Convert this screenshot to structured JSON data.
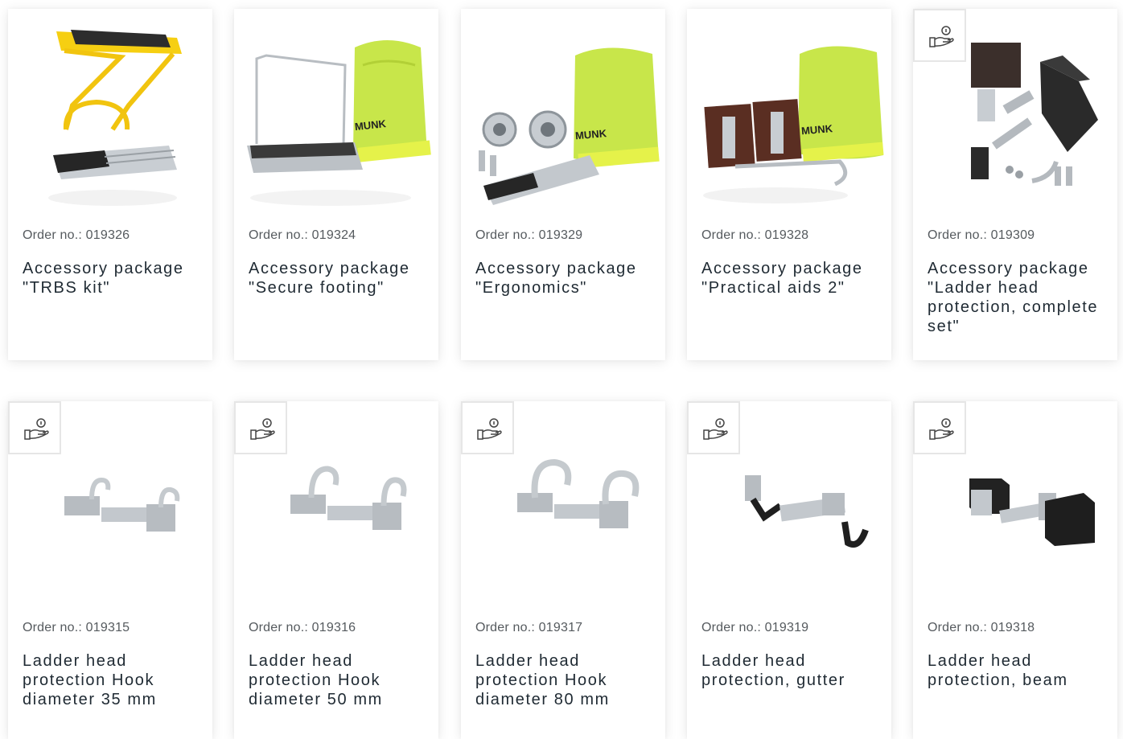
{
  "products": [
    {
      "order_label": "Order no.: 019326",
      "title": "Accessory package \"TRBS kit\"",
      "badge": false,
      "image": "yellow-platform-step"
    },
    {
      "order_label": "Order no.: 019324",
      "title": "Accessory package \"Secure footing\"",
      "badge": false,
      "image": "platform-with-bag"
    },
    {
      "order_label": "Order no.: 019329",
      "title": "Accessory package \"Ergonomics\"",
      "badge": false,
      "image": "wheels-step-bag"
    },
    {
      "order_label": "Order no.: 019328",
      "title": "Accessory package \"Practical aids 2\"",
      "badge": false,
      "image": "pads-hooks-bag"
    },
    {
      "order_label": "Order no.: 019309",
      "title": "Accessory package \"Ladder head protection, complete set\"",
      "badge": true,
      "image": "ladder-head-set"
    },
    {
      "order_label": "Order no.: 019315",
      "title": "Ladder head protection Hook diameter 35 mm",
      "badge": true,
      "image": "hook-35"
    },
    {
      "order_label": "Order no.: 019316",
      "title": "Ladder head protection Hook diameter 50 mm",
      "badge": true,
      "image": "hook-50"
    },
    {
      "order_label": "Order no.: 019317",
      "title": "Ladder head protection Hook diameter 80 mm",
      "badge": true,
      "image": "hook-80"
    },
    {
      "order_label": "Order no.: 019319",
      "title": "Ladder head protection, gutter",
      "badge": true,
      "image": "gutter-hook"
    },
    {
      "order_label": "Order no.: 019318",
      "title": "Ladder head protection, beam",
      "badge": true,
      "image": "beam-brackets"
    }
  ],
  "bag_brand": "MUNK",
  "badge_icon": "hand-coin-icon",
  "colors": {
    "yellow": "#f6cf12",
    "lime": "#c8e64a",
    "metal": "#b9bec3",
    "dark": "#2b2b2b",
    "text": "#1f2a33",
    "muted": "#555a5e"
  }
}
